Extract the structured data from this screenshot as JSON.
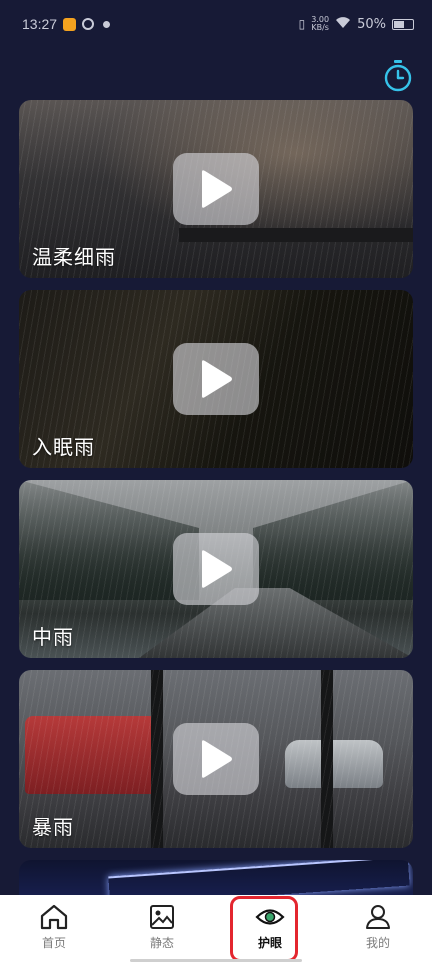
{
  "status_bar": {
    "time": "13:27",
    "net_speed_value": "3.00",
    "net_speed_unit": "KB/s",
    "battery": "50%"
  },
  "header": {
    "timer_icon": "stopwatch-icon",
    "accent_color": "#36c3ea"
  },
  "cards": [
    {
      "title": "温柔细雨",
      "icon": "play-icon"
    },
    {
      "title": "入眠雨",
      "icon": "play-icon"
    },
    {
      "title": "中雨",
      "icon": "play-icon"
    },
    {
      "title": "暴雨",
      "icon": "play-icon"
    }
  ],
  "bottom_nav": {
    "items": [
      {
        "label": "首页",
        "icon": "home-icon",
        "active": false
      },
      {
        "label": "静态",
        "icon": "image-icon",
        "active": false
      },
      {
        "label": "护眼",
        "icon": "eye-icon",
        "active": true
      },
      {
        "label": "我的",
        "icon": "user-icon",
        "active": false
      }
    ],
    "highlight_color": "#e3262f"
  }
}
